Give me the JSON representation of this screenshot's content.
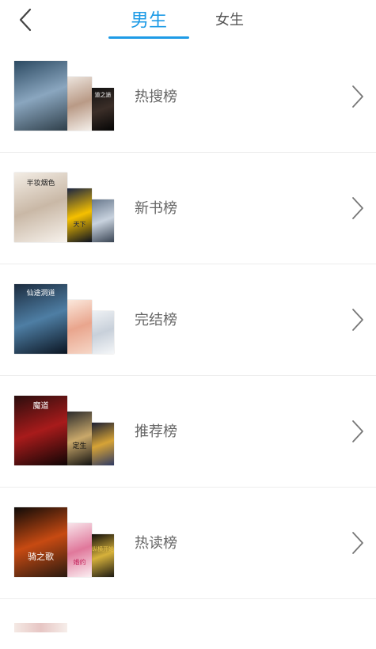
{
  "header": {
    "back_icon": "chevron-left-icon",
    "tabs": [
      {
        "label": "男生",
        "active": true
      },
      {
        "label": "女生",
        "active": false
      }
    ],
    "accent_color": "#1e9be6"
  },
  "rankings": [
    {
      "label": "热搜榜",
      "covers": [
        {
          "caption": "",
          "colors": [
            "#2c4a62",
            "#8aa6bf",
            "#2f3f4a"
          ]
        },
        {
          "caption": "",
          "colors": [
            "#ece4dd",
            "#b99a86",
            "#f4efea"
          ]
        },
        {
          "caption": "道之途",
          "colors": [
            "#111111",
            "#3b2e28",
            "#050505"
          ]
        }
      ]
    },
    {
      "label": "新书榜",
      "covers": [
        {
          "caption": "半妆烟色",
          "colors": [
            "#f3ede5",
            "#c9b8a6",
            "#f7f2ec"
          ]
        },
        {
          "caption": "天下",
          "colors": [
            "#1a2442",
            "#f5c000",
            "#0a1020"
          ]
        },
        {
          "caption": "",
          "colors": [
            "#6a7a8e",
            "#c8d2de",
            "#3a4554"
          ]
        }
      ]
    },
    {
      "label": "完结榜",
      "covers": [
        {
          "caption": "仙途洞道",
          "colors": [
            "#1b2b3e",
            "#4e7ea4",
            "#0b1522"
          ]
        },
        {
          "caption": "",
          "colors": [
            "#fbe8dc",
            "#e9a58d",
            "#f6d6c6"
          ]
        },
        {
          "caption": "",
          "colors": [
            "#eef1f4",
            "#c8d0da",
            "#f4f6f8"
          ]
        }
      ]
    },
    {
      "label": "推荐榜",
      "covers": [
        {
          "caption": "魔道",
          "colors": [
            "#2a0d0d",
            "#a81b1b",
            "#0f0505"
          ]
        },
        {
          "caption": "定生",
          "colors": [
            "#2c2c2c",
            "#c9a86a",
            "#111111"
          ]
        },
        {
          "caption": "",
          "colors": [
            "#1b1f33",
            "#d6a336",
            "#2f3a63"
          ]
        }
      ]
    },
    {
      "label": "热读榜",
      "covers": [
        {
          "caption": "骑之歌",
          "colors": [
            "#0e0a08",
            "#c74a12",
            "#2a1a10"
          ]
        },
        {
          "caption": "婚约",
          "colors": [
            "#f8e4ea",
            "#e0789b",
            "#fbeff2"
          ]
        },
        {
          "caption": "纵横开始",
          "colors": [
            "#0f0d0a",
            "#d6b13b",
            "#1d1a13"
          ]
        }
      ]
    }
  ],
  "row_arrow_icon": "chevron-right-icon"
}
